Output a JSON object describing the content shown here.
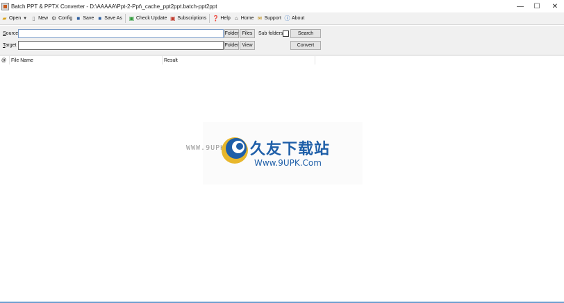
{
  "window": {
    "title": "Batch PPT & PPTX Converter - D:\\AAAAA\\Ppt-2-Ppt\\_cache_ppt2ppt.batch-ppt2ppt",
    "min_glyph": "—",
    "max_glyph": "☐",
    "close_glyph": "✕"
  },
  "toolbar": {
    "open": "Open",
    "new": "New",
    "config": "Config",
    "save": "Save",
    "save_as": "Save As",
    "check_update": "Check Update",
    "subscriptions": "Subscriptions",
    "help": "Help",
    "home": "Home",
    "support": "Support",
    "about": "About"
  },
  "form": {
    "source_label_u": "S",
    "source_label_rest": "ource",
    "target_label_u": "T",
    "target_label_rest": "arget",
    "source_value": "",
    "target_value": "",
    "folder": "Folder",
    "files": "Files",
    "sub_folders": "Sub folders",
    "search": "Search",
    "view": "View",
    "convert": "Convert"
  },
  "list": {
    "columns": [
      "@",
      "File Name",
      "Result"
    ],
    "rows": []
  },
  "watermark": {
    "www": "WWW.9UPK.com",
    "cn": "久友下载站",
    "url": "Www.9UPK.Com"
  },
  "colors": {
    "watermark_blue": "#1f5fa8",
    "input_focus_border": "#7a9cc8"
  }
}
